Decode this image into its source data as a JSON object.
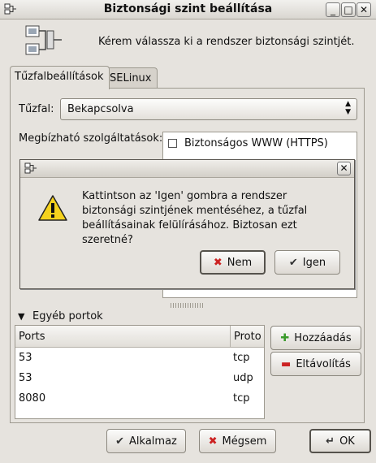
{
  "window": {
    "title": "Biztonsági szint beállítása",
    "minimize_glyph": "_",
    "maximize_glyph": "□",
    "close_glyph": "✕"
  },
  "header": {
    "instruction": "Kérem válassza ki a rendszer biztonsági szintjét.",
    "icon": "network-firewall-icon"
  },
  "tabs": [
    {
      "label": "Tűzfalbeállítások",
      "active": true
    },
    {
      "label": "SELinux",
      "active": false
    }
  ],
  "firewall": {
    "label": "Tűzfal:",
    "value": "Bekapcsolva"
  },
  "trusted_services": {
    "label": "Megbízható szolgáltatások:",
    "items": [
      {
        "label": "Biztonságos WWW (HTTPS)",
        "checked": false
      }
    ]
  },
  "other_ports": {
    "expander_label": "Egyéb portok",
    "columns": {
      "ports": "Ports",
      "proto": "Proto"
    },
    "rows": [
      {
        "port": "53",
        "proto": "tcp"
      },
      {
        "port": "53",
        "proto": "udp"
      },
      {
        "port": "8080",
        "proto": "tcp"
      }
    ],
    "add_label": "Hozzáadás",
    "remove_label": "Eltávolítás"
  },
  "dialog": {
    "message": "Kattintson az 'Igen' gombra a rendszer biztonsági szintjének mentéséhez, a tűzfal beállításainak felülírásához. Biztosan ezt szeretné?",
    "no_label": "Nem",
    "yes_label": "Igen",
    "icon": "warning-icon"
  },
  "footer": {
    "apply_label": "Alkalmaz",
    "cancel_label": "Mégsem",
    "ok_label": "OK"
  },
  "colors": {
    "background": "#e6e3de",
    "warning": "#f5d21d",
    "remove_red": "#cc2222",
    "add_green": "#3a9a2a"
  }
}
